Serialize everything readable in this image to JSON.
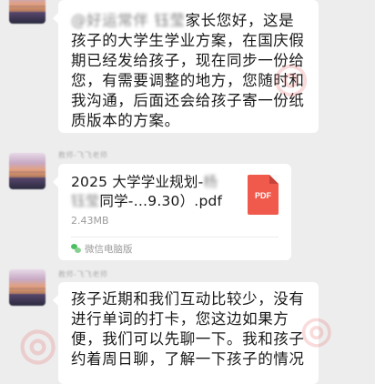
{
  "messages": [
    {
      "mention": "@好运常伴 钰莹",
      "text": "家长您好，这是孩子的大学生学业方案，在国庆假期已经发给孩子，现在同步一份给您，有需要调整的地方，您随时和我沟通，后面还会给孩子寄一份纸质版本的方案。"
    },
    {
      "sender": "教师-飞飞老师",
      "file": {
        "name_start": "2025 大学学业规划-",
        "name_blur1": "杨",
        "name_blur2": "钰莹",
        "name_end": "同学-…9.30）.pdf",
        "size": "2.43MB",
        "icon_label": "PDF",
        "source": "微信电脑版"
      }
    },
    {
      "sender": "教师-飞飞老师",
      "text": "孩子近期和我们互动比较少，没有进行单词的打卡，您这边如果方便，我们可以先聊一下。我和孩子约着周日聊，了解一下孩子的情况"
    }
  ],
  "colors": {
    "background": "#ededed",
    "bubble": "#ffffff",
    "pdf_icon": "#f05a4d",
    "wechat_green": "#4cbf60"
  }
}
